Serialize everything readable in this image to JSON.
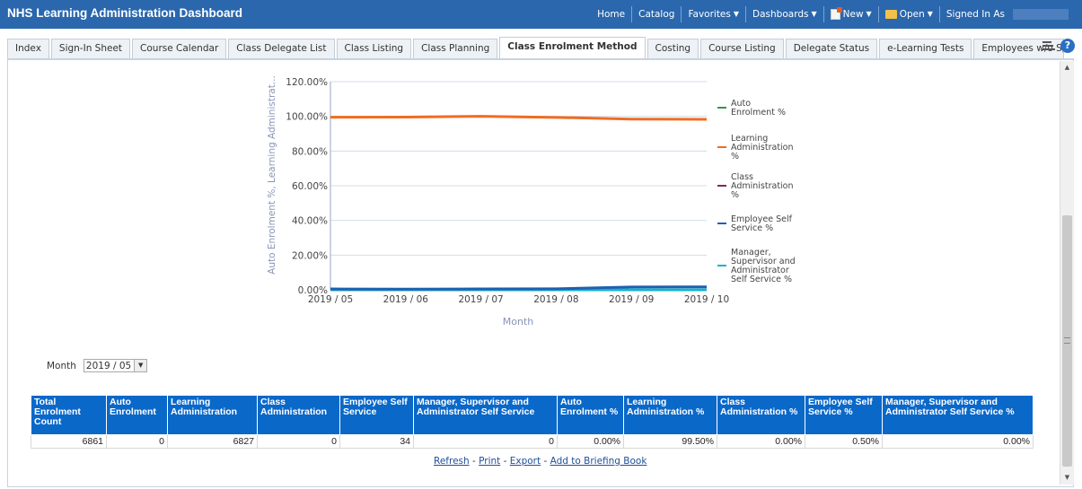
{
  "app": {
    "title": "NHS Learning Administration Dashboard",
    "nav": {
      "home": "Home",
      "catalog": "Catalog",
      "favorites": "Favorites",
      "dashboards": "Dashboards",
      "new": "New",
      "open": "Open",
      "signed_in": "Signed In As"
    }
  },
  "tabs": [
    {
      "label": "Index"
    },
    {
      "label": "Sign-In Sheet"
    },
    {
      "label": "Course Calendar"
    },
    {
      "label": "Class Delegate List"
    },
    {
      "label": "Class Listing"
    },
    {
      "label": "Class Planning"
    },
    {
      "label": "Class Enrolment Method",
      "active": true
    },
    {
      "label": "Costing"
    },
    {
      "label": "Course Listing"
    },
    {
      "label": "Delegate Status"
    },
    {
      "label": "e-Learning Tests"
    },
    {
      "label": "Employees w/o Specific Co"
    }
  ],
  "tab_overflow": "»",
  "chart_data": {
    "type": "line",
    "x": [
      "2019 / 05",
      "2019 / 06",
      "2019 / 07",
      "2019 / 08",
      "2019 / 09",
      "2019 / 10"
    ],
    "xlabel": "Month",
    "ylabel": "Auto Enrolment %, Learning Administrat...",
    "ylim": [
      0,
      120
    ],
    "y_ticks": [
      "0.00%",
      "20.00%",
      "40.00%",
      "60.00%",
      "80.00%",
      "100.00%",
      "120.00%"
    ],
    "grid": true,
    "legend_position": "right",
    "series": [
      {
        "name": "Auto Enrolment %",
        "color": "#2e9a44",
        "values": [
          0,
          0,
          0,
          0,
          0,
          0
        ]
      },
      {
        "name": "Learning Administration %",
        "color": "#f26b21",
        "values": [
          99.5,
          99.6,
          100.0,
          99.4,
          98.4,
          98.3
        ]
      },
      {
        "name": "Class Administration %",
        "color": "#7d2a5d",
        "values": [
          0,
          0,
          0,
          0,
          0,
          0
        ]
      },
      {
        "name": "Employee Self Service %",
        "color": "#1f5fb0",
        "values": [
          0.5,
          0.4,
          0.5,
          0.6,
          1.6,
          1.7
        ]
      },
      {
        "name": "Manager, Supervisor and Administrator Self Service %",
        "color": "#19b2cf",
        "values": [
          0,
          0,
          0,
          0,
          0,
          0
        ]
      }
    ]
  },
  "month_filter": {
    "label": "Month",
    "value": "2019 / 05"
  },
  "table": {
    "headers": [
      "Total Enrolment Count",
      "Auto Enrolment",
      "Learning Administration",
      "Class Administration",
      "Employee Self Service",
      "Manager, Supervisor and Administrator Self Service",
      "Auto Enrolment %",
      "Learning Administration %",
      "Class Administration %",
      "Employee Self Service %",
      "Manager, Supervisor and Administrator Self Service %"
    ],
    "rows": [
      [
        "6861",
        "0",
        "6827",
        "0",
        "34",
        "0",
        "0.00%",
        "99.50%",
        "0.00%",
        "0.50%",
        "0.00%"
      ]
    ]
  },
  "links": {
    "refresh": "Refresh",
    "print": "Print",
    "export": "Export",
    "briefing": "Add to Briefing Book",
    "sep": " - "
  }
}
